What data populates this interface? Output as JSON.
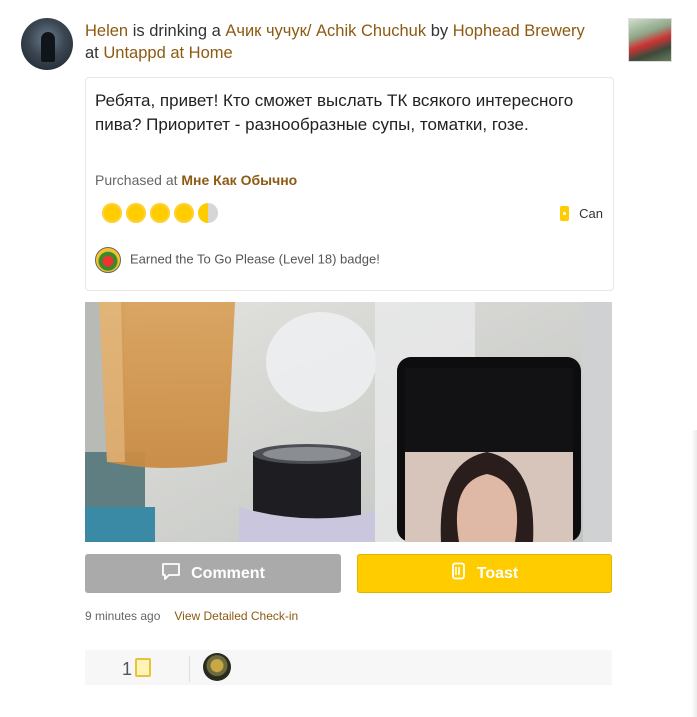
{
  "checkin": {
    "user": "Helen",
    "verb": " is drinking a ",
    "beer": "Ачик чучук/ Achik Chuchuk",
    "by": " by ",
    "brewery": "Hophead Brewery",
    "at": " at ",
    "venue": "Untappd at Home",
    "comment": "Ребята, привет! Кто сможет выслать ТК всякого интересного пива? Приоритет - разнообразные супы, томатки, гозе.",
    "purchased_prefix": "Purchased at ",
    "purchased_place": "Мне Как Обычно",
    "rating": 4.5,
    "rating_max": 5,
    "serving": "Can",
    "badge_text": "Earned the To Go Please (Level 18) badge!",
    "time_ago": "9 minutes ago",
    "detail_link": "View Detailed Check-in",
    "toast_count": "1"
  },
  "actions": {
    "comment_label": "Comment",
    "toast_label": "Toast"
  },
  "colors": {
    "accent_link": "#8c5a12",
    "toast_yellow": "#ffcc00",
    "comment_gray": "#aaaaaa"
  },
  "icons": [
    "user-avatar",
    "beer-label",
    "bottle-cap-rating",
    "can-icon",
    "badge-icon",
    "comment-bubble-icon",
    "toast-mug-icon"
  ]
}
